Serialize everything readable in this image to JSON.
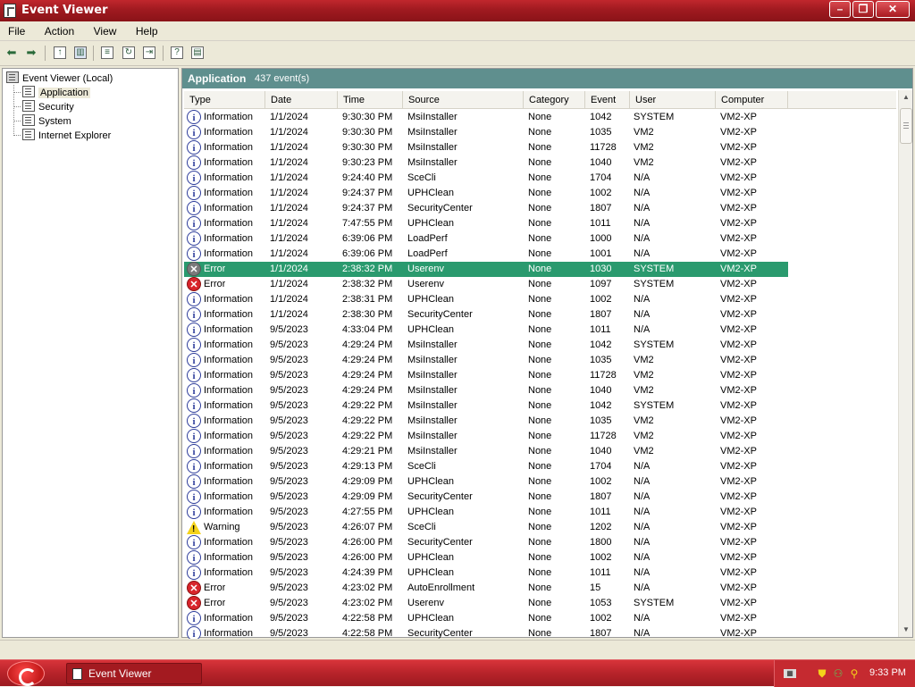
{
  "window": {
    "title": "Event Viewer"
  },
  "menu": [
    "File",
    "Action",
    "View",
    "Help"
  ],
  "tree": {
    "root": "Event Viewer (Local)",
    "items": [
      "Application",
      "Security",
      "System",
      "Internet Explorer"
    ],
    "selected": "Application"
  },
  "panel": {
    "title": "Application",
    "count": "437 event(s)"
  },
  "columns": [
    "Type",
    "Date",
    "Time",
    "Source",
    "Category",
    "Event",
    "User",
    "Computer"
  ],
  "rows": [
    [
      "Information",
      "1/1/2024",
      "9:30:30 PM",
      "MsiInstaller",
      "None",
      "1042",
      "SYSTEM",
      "VM2-XP"
    ],
    [
      "Information",
      "1/1/2024",
      "9:30:30 PM",
      "MsiInstaller",
      "None",
      "1035",
      "VM2",
      "VM2-XP"
    ],
    [
      "Information",
      "1/1/2024",
      "9:30:30 PM",
      "MsiInstaller",
      "None",
      "11728",
      "VM2",
      "VM2-XP"
    ],
    [
      "Information",
      "1/1/2024",
      "9:30:23 PM",
      "MsiInstaller",
      "None",
      "1040",
      "VM2",
      "VM2-XP"
    ],
    [
      "Information",
      "1/1/2024",
      "9:24:40 PM",
      "SceCli",
      "None",
      "1704",
      "N/A",
      "VM2-XP"
    ],
    [
      "Information",
      "1/1/2024",
      "9:24:37 PM",
      "UPHClean",
      "None",
      "1002",
      "N/A",
      "VM2-XP"
    ],
    [
      "Information",
      "1/1/2024",
      "9:24:37 PM",
      "SecurityCenter",
      "None",
      "1807",
      "N/A",
      "VM2-XP"
    ],
    [
      "Information",
      "1/1/2024",
      "7:47:55 PM",
      "UPHClean",
      "None",
      "1011",
      "N/A",
      "VM2-XP"
    ],
    [
      "Information",
      "1/1/2024",
      "6:39:06 PM",
      "LoadPerf",
      "None",
      "1000",
      "N/A",
      "VM2-XP"
    ],
    [
      "Information",
      "1/1/2024",
      "6:39:06 PM",
      "LoadPerf",
      "None",
      "1001",
      "N/A",
      "VM2-XP"
    ],
    [
      "Error",
      "1/1/2024",
      "2:38:32 PM",
      "Userenv",
      "None",
      "1030",
      "SYSTEM",
      "VM2-XP"
    ],
    [
      "Error",
      "1/1/2024",
      "2:38:32 PM",
      "Userenv",
      "None",
      "1097",
      "SYSTEM",
      "VM2-XP"
    ],
    [
      "Information",
      "1/1/2024",
      "2:38:31 PM",
      "UPHClean",
      "None",
      "1002",
      "N/A",
      "VM2-XP"
    ],
    [
      "Information",
      "1/1/2024",
      "2:38:30 PM",
      "SecurityCenter",
      "None",
      "1807",
      "N/A",
      "VM2-XP"
    ],
    [
      "Information",
      "9/5/2023",
      "4:33:04 PM",
      "UPHClean",
      "None",
      "1011",
      "N/A",
      "VM2-XP"
    ],
    [
      "Information",
      "9/5/2023",
      "4:29:24 PM",
      "MsiInstaller",
      "None",
      "1042",
      "SYSTEM",
      "VM2-XP"
    ],
    [
      "Information",
      "9/5/2023",
      "4:29:24 PM",
      "MsiInstaller",
      "None",
      "1035",
      "VM2",
      "VM2-XP"
    ],
    [
      "Information",
      "9/5/2023",
      "4:29:24 PM",
      "MsiInstaller",
      "None",
      "11728",
      "VM2",
      "VM2-XP"
    ],
    [
      "Information",
      "9/5/2023",
      "4:29:24 PM",
      "MsiInstaller",
      "None",
      "1040",
      "VM2",
      "VM2-XP"
    ],
    [
      "Information",
      "9/5/2023",
      "4:29:22 PM",
      "MsiInstaller",
      "None",
      "1042",
      "SYSTEM",
      "VM2-XP"
    ],
    [
      "Information",
      "9/5/2023",
      "4:29:22 PM",
      "MsiInstaller",
      "None",
      "1035",
      "VM2",
      "VM2-XP"
    ],
    [
      "Information",
      "9/5/2023",
      "4:29:22 PM",
      "MsiInstaller",
      "None",
      "11728",
      "VM2",
      "VM2-XP"
    ],
    [
      "Information",
      "9/5/2023",
      "4:29:21 PM",
      "MsiInstaller",
      "None",
      "1040",
      "VM2",
      "VM2-XP"
    ],
    [
      "Information",
      "9/5/2023",
      "4:29:13 PM",
      "SceCli",
      "None",
      "1704",
      "N/A",
      "VM2-XP"
    ],
    [
      "Information",
      "9/5/2023",
      "4:29:09 PM",
      "UPHClean",
      "None",
      "1002",
      "N/A",
      "VM2-XP"
    ],
    [
      "Information",
      "9/5/2023",
      "4:29:09 PM",
      "SecurityCenter",
      "None",
      "1807",
      "N/A",
      "VM2-XP"
    ],
    [
      "Information",
      "9/5/2023",
      "4:27:55 PM",
      "UPHClean",
      "None",
      "1011",
      "N/A",
      "VM2-XP"
    ],
    [
      "Warning",
      "9/5/2023",
      "4:26:07 PM",
      "SceCli",
      "None",
      "1202",
      "N/A",
      "VM2-XP"
    ],
    [
      "Information",
      "9/5/2023",
      "4:26:00 PM",
      "SecurityCenter",
      "None",
      "1800",
      "N/A",
      "VM2-XP"
    ],
    [
      "Information",
      "9/5/2023",
      "4:26:00 PM",
      "UPHClean",
      "None",
      "1002",
      "N/A",
      "VM2-XP"
    ],
    [
      "Information",
      "9/5/2023",
      "4:24:39 PM",
      "UPHClean",
      "None",
      "1011",
      "N/A",
      "VM2-XP"
    ],
    [
      "Error",
      "9/5/2023",
      "4:23:02 PM",
      "AutoEnrollment",
      "None",
      "15",
      "N/A",
      "VM2-XP"
    ],
    [
      "Error",
      "9/5/2023",
      "4:23:02 PM",
      "Userenv",
      "None",
      "1053",
      "SYSTEM",
      "VM2-XP"
    ],
    [
      "Information",
      "9/5/2023",
      "4:22:58 PM",
      "UPHClean",
      "None",
      "1002",
      "N/A",
      "VM2-XP"
    ],
    [
      "Information",
      "9/5/2023",
      "4:22:58 PM",
      "SecurityCenter",
      "None",
      "1807",
      "N/A",
      "VM2-XP"
    ]
  ],
  "selected_row": 10,
  "taskbar": {
    "task": "Event Viewer",
    "clock": "9:33 PM"
  },
  "colors": {
    "titlebar": "#a01a20",
    "selection": "#2a9a6e",
    "panel_header": "#5f8f8e"
  }
}
